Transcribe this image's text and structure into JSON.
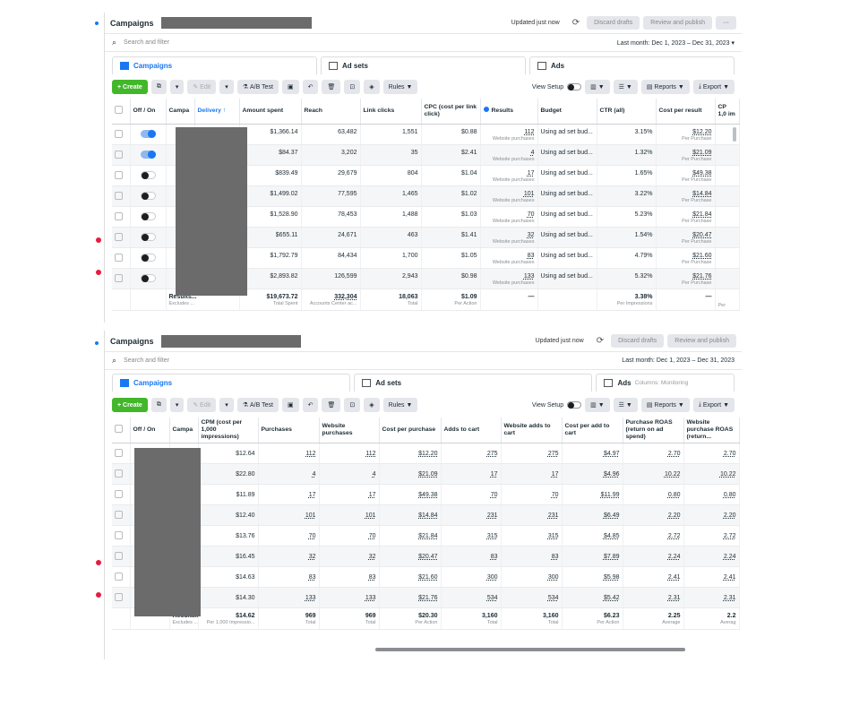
{
  "colors": {
    "accent": "#1877f2",
    "create": "#42b72a",
    "redaction": "#6b6b6b",
    "notif": "#e41e3f"
  },
  "panel1": {
    "header": {
      "title": "Campaigns",
      "updated": "Updated just now",
      "discard": "Discard drafts",
      "review": "Review and publish",
      "more": "···"
    },
    "search": {
      "placeholder": "Search and filter",
      "range": "Last month: Dec 1, 2023 – Dec 31, 2023"
    },
    "tabs": {
      "campaigns": "Campaigns",
      "adsets": "Ad sets",
      "ads": "Ads"
    },
    "toolbar": {
      "create": "+ Create",
      "edit": "Edit",
      "ab": "A/B Test",
      "rules": "Rules",
      "view_setup": "View Setup",
      "reports": "Reports",
      "export": "Export"
    },
    "columns": [
      "Off / On",
      "Campa",
      "Delivery ↑",
      "Amount spent",
      "Reach",
      "Link clicks",
      "CPC (cost per link click)",
      "Results",
      "Budget",
      "CTR (all)",
      "Cost per result",
      "CP 1,0 im"
    ],
    "rows": [
      {
        "on": true,
        "spent": "$1,366.14",
        "reach": "63,482",
        "clicks": "1,551",
        "cpc": "$0.88",
        "results": "112",
        "res_sub": "Website purchases",
        "budget": "Using ad set bud...",
        "ctr": "3.15%",
        "cpr": "$12.20",
        "cpr_sub": "Per Purchase"
      },
      {
        "on": true,
        "spent": "$84.37",
        "reach": "3,202",
        "clicks": "35",
        "cpc": "$2.41",
        "results": "4",
        "res_sub": "Website purchases",
        "budget": "Using ad set bud...",
        "ctr": "1.32%",
        "cpr": "$21.09",
        "cpr_sub": "Per Purchase"
      },
      {
        "on": false,
        "spent": "$839.49",
        "reach": "29,679",
        "clicks": "804",
        "cpc": "$1.04",
        "results": "17",
        "res_sub": "Website purchases",
        "budget": "Using ad set bud...",
        "ctr": "1.65%",
        "cpr": "$49.38",
        "cpr_sub": "Per Purchase"
      },
      {
        "on": false,
        "spent": "$1,499.02",
        "reach": "77,595",
        "clicks": "1,465",
        "cpc": "$1.02",
        "results": "101",
        "res_sub": "Website purchases",
        "budget": "Using ad set bud...",
        "ctr": "3.22%",
        "cpr": "$14.84",
        "cpr_sub": "Per Purchase"
      },
      {
        "on": false,
        "spent": "$1,528.90",
        "reach": "78,453",
        "clicks": "1,488",
        "cpc": "$1.03",
        "results": "70",
        "res_sub": "Website purchases",
        "budget": "Using ad set bud...",
        "ctr": "5.23%",
        "cpr": "$21.84",
        "cpr_sub": "Per Purchase"
      },
      {
        "on": false,
        "spent": "$655.11",
        "reach": "24,671",
        "clicks": "463",
        "cpc": "$1.41",
        "results": "32",
        "res_sub": "Website purchases",
        "budget": "Using ad set bud...",
        "ctr": "1.54%",
        "cpr": "$20.47",
        "cpr_sub": "Per Purchase"
      },
      {
        "on": false,
        "spent": "$1,792.79",
        "reach": "84,434",
        "clicks": "1,700",
        "cpc": "$1.05",
        "results": "83",
        "res_sub": "Website purchases",
        "budget": "Using ad set bud...",
        "ctr": "4.79%",
        "cpr": "$21.60",
        "cpr_sub": "Per Purchase"
      },
      {
        "on": false,
        "spent": "$2,893.82",
        "reach": "126,599",
        "clicks": "2,943",
        "cpc": "$0.98",
        "results": "133",
        "res_sub": "Website purchases",
        "budget": "Using ad set bud...",
        "ctr": "5.32%",
        "cpr": "$21.76",
        "cpr_sub": "Per Purchase"
      }
    ],
    "totals": {
      "label": "Results...",
      "label_sub": "Excludes ...",
      "spent": "$19,673.72",
      "spent_sub": "Total Spent",
      "reach": "332,304",
      "reach_sub": "Accounts Center ac...",
      "clicks": "18,063",
      "clicks_sub": "Total",
      "cpc": "$1.09",
      "cpc_sub": "Per Action",
      "results": "—",
      "ctr": "3.38%",
      "ctr_sub": "Per Impressions",
      "cpr": "—",
      "cp_sub": "Per"
    }
  },
  "panel2": {
    "header": {
      "title": "Campaigns",
      "updated": "Updated just now",
      "discard": "Discard drafts",
      "review": "Review and publish"
    },
    "search": {
      "placeholder": "Search and filter",
      "range": "Last month: Dec 1, 2023 – Dec 31, 2023"
    },
    "tabs": {
      "campaigns": "Campaigns",
      "adsets": "Ad sets",
      "ads": "Ads",
      "ads_sub": "Columns: Monitoring"
    },
    "toolbar": {
      "create": "+ Create",
      "edit": "Edit",
      "ab": "A/B Test",
      "rules": "Rules",
      "view_setup": "View Setup",
      "reports": "Reports",
      "export": "Export"
    },
    "columns": [
      "Off / On",
      "Campa",
      "CPM (cost per 1,000 impressions)",
      "Purchases",
      "Website purchases",
      "Cost per purchase",
      "Adds to cart",
      "Website adds to cart",
      "Cost per add to cart",
      "Purchase ROAS (return on ad spend)",
      "Website purchase ROAS (return..."
    ],
    "rows": [
      {
        "cpm": "$12.64",
        "purch": "112",
        "wpurch": "112",
        "cpp": "$12.20",
        "atc": "275",
        "watc": "275",
        "cpatc": "$4.97",
        "roas": "2.70",
        "wroas": "2.70"
      },
      {
        "cpm": "$22.80",
        "purch": "4",
        "wpurch": "4",
        "cpp": "$21.09",
        "atc": "17",
        "watc": "17",
        "cpatc": "$4.96",
        "roas": "10.22",
        "wroas": "10.22"
      },
      {
        "cpm": "$11.89",
        "purch": "17",
        "wpurch": "17",
        "cpp": "$49.38",
        "atc": "70",
        "watc": "70",
        "cpatc": "$11.99",
        "roas": "0.80",
        "wroas": "0.80"
      },
      {
        "cpm": "$12.40",
        "purch": "101",
        "wpurch": "101",
        "cpp": "$14.84",
        "atc": "231",
        "watc": "231",
        "cpatc": "$6.49",
        "roas": "2.20",
        "wroas": "2.20"
      },
      {
        "cpm": "$13.76",
        "purch": "70",
        "wpurch": "70",
        "cpp": "$21.84",
        "atc": "315",
        "watc": "315",
        "cpatc": "$4.85",
        "roas": "2.72",
        "wroas": "2.72"
      },
      {
        "cpm": "$16.45",
        "purch": "32",
        "wpurch": "32",
        "cpp": "$20.47",
        "atc": "83",
        "watc": "83",
        "cpatc": "$7.89",
        "roas": "2.24",
        "wroas": "2.24"
      },
      {
        "cpm": "$14.63",
        "purch": "83",
        "wpurch": "83",
        "cpp": "$21.60",
        "atc": "300",
        "watc": "300",
        "cpatc": "$5.98",
        "roas": "2.41",
        "wroas": "2.41"
      },
      {
        "cpm": "$14.30",
        "purch": "133",
        "wpurch": "133",
        "cpp": "$21.76",
        "atc": "534",
        "watc": "534",
        "cpatc": "$5.42",
        "roas": "2.31",
        "wroas": "2.31"
      }
    ],
    "totals": {
      "label": "Results...",
      "label_sub": "Excludes ...",
      "cpm": "$14.62",
      "cpm_sub": "Per 1,000 Impressio...",
      "purch": "969",
      "purch_sub": "Total",
      "wpurch": "969",
      "wpurch_sub": "Total",
      "cpp": "$20.30",
      "cpp_sub": "Per Action",
      "atc": "3,160",
      "atc_sub": "Total",
      "watc": "3,160",
      "watc_sub": "Total",
      "cpatc": "$6.23",
      "cpatc_sub": "Per Action",
      "roas": "2.25",
      "roas_sub": "Average",
      "wroas": "2.2",
      "wroas_sub": "Averag"
    }
  }
}
